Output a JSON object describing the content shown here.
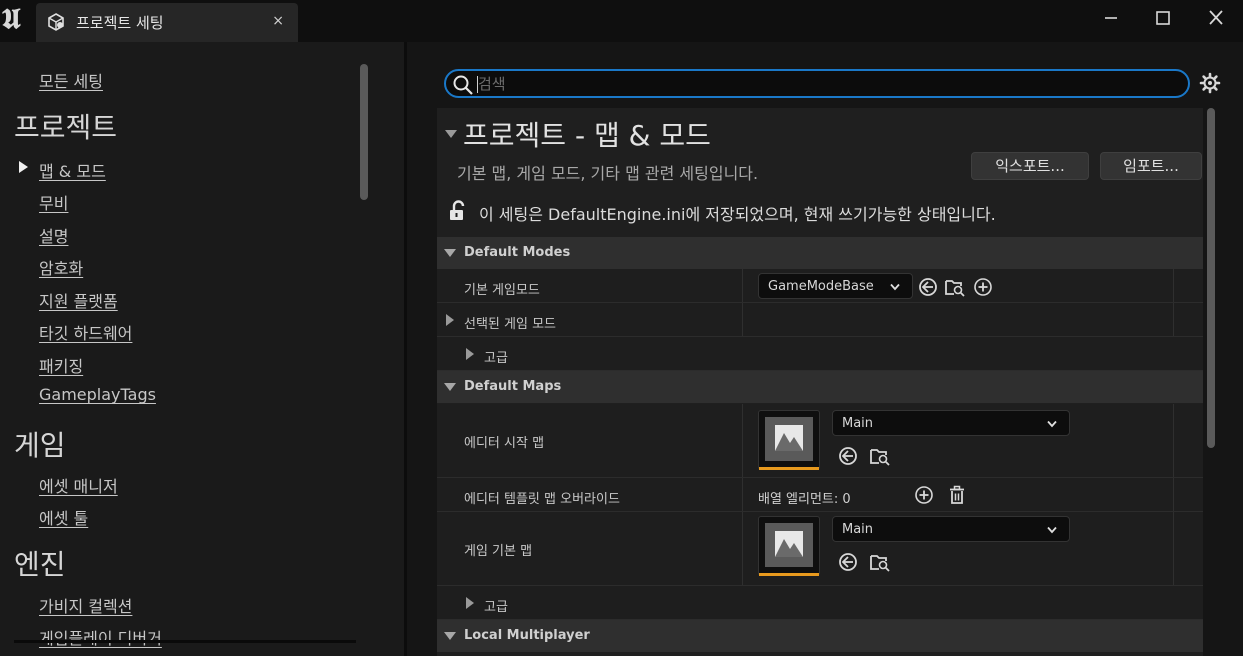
{
  "window": {
    "tab_title": "프로젝트 세팅",
    "close_glyph": "×"
  },
  "sidebar": {
    "all_settings": "모든 세팅",
    "categories": [
      {
        "title": "프로젝트",
        "items": [
          "맵 & 모드",
          "무비",
          "설명",
          "암호화",
          "지원 플랫폼",
          "타깃 하드웨어",
          "패키징",
          "GameplayTags"
        ]
      },
      {
        "title": "게임",
        "items": [
          "에셋 매니저",
          "에셋 툴"
        ]
      },
      {
        "title": "엔진",
        "items": [
          "가비지 컬렉션",
          "게임플레이 디버거"
        ]
      }
    ],
    "selected_item": "맵 & 모드"
  },
  "search": {
    "placeholder": "검색"
  },
  "page": {
    "title": "프로젝트 - 맵 & 모드",
    "description": "기본 맵, 게임 모드, 기타 맵 관련 세팅입니다.",
    "export_label": "익스포트...",
    "import_label": "임포트...",
    "config_note": "이 세팅은 DefaultEngine.ini에 저장되었으며, 현재 쓰기가능한 상태입니다."
  },
  "sections": {
    "default_modes": {
      "title": "Default Modes",
      "default_gamemode_label": "기본 게임모드",
      "default_gamemode_value": "GameModeBase",
      "selected_gamemode_label": "선택된 게임 모드",
      "advanced_label": "고급"
    },
    "default_maps": {
      "title": "Default Maps",
      "editor_startup_map_label": "에디터 시작 맵",
      "editor_startup_map_value": "Main",
      "editor_template_override_label": "에디터 템플릿 맵 오버라이드",
      "array_elements": "배열 엘리먼트: 0",
      "game_default_map_label": "게임 기본 맵",
      "game_default_map_value": "Main",
      "advanced_label": "고급"
    },
    "local_multiplayer": {
      "title": "Local Multiplayer"
    }
  },
  "colors": {
    "accent_blue": "#1a78c8",
    "thumbnail_underline": "#e89a1e"
  }
}
